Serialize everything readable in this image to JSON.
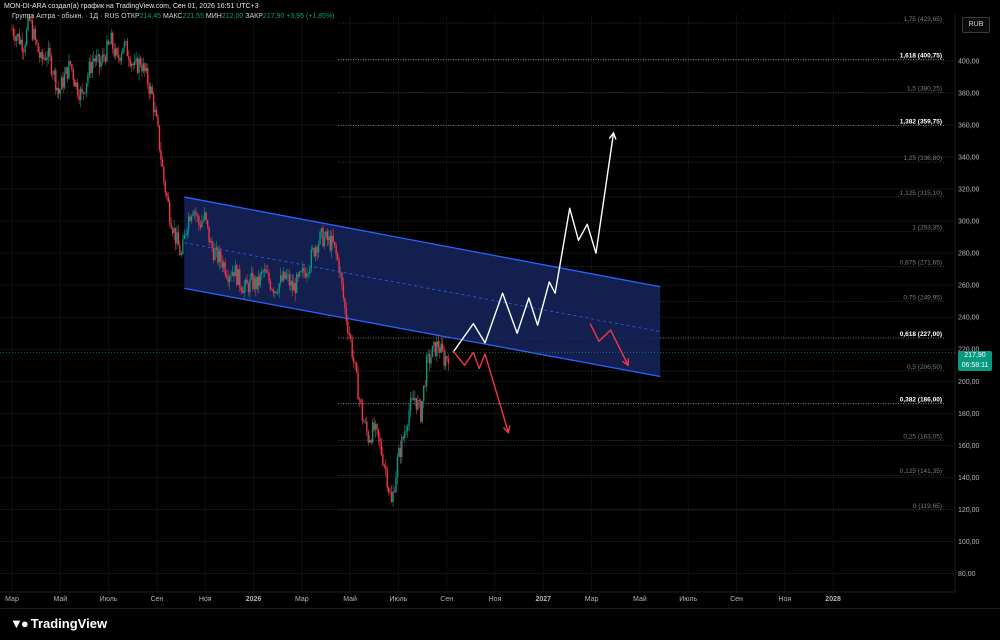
{
  "header": {
    "attribution": "MON-DI-ARA создал(а) график на TradingView.com, Сен 01, 2026 16:51 UTC+3",
    "symbol_line": "Группа Астра - обыкн. · 1Д · RUS",
    "open_label": "ОТКР",
    "open_value": "214,45",
    "high_label": "МАКС",
    "high_value": "221,55",
    "low_label": "МИН",
    "low_value": "212,00",
    "close_label": "ЗАКР",
    "close_value": "217,90",
    "change": "+3,95 (+1,85%)"
  },
  "price_axis": {
    "currency": "RUB",
    "last_price": "217,90",
    "countdown": "06:58:11"
  },
  "footer": {
    "brand": "TradingView"
  },
  "colors": {
    "background": "#000000",
    "bull": "#089981",
    "bear": "#f23645",
    "channel_line": "#2962ff",
    "channel_fill": "#16255c",
    "fib_line": "#787b86",
    "scenario_up": "#ffffff",
    "scenario_down": "#f23645",
    "badge": "#089981"
  },
  "chart_data": {
    "type": "candlestick",
    "ylim": [
      75,
      430
    ],
    "price_ticks": [
      "400,00",
      "380,00",
      "360,00",
      "340,00",
      "320,00",
      "300,00",
      "280,00",
      "260,00",
      "240,00",
      "220,00",
      "200,00",
      "180,00",
      "160,00",
      "140,00",
      "120,00",
      "100,00",
      "80,00"
    ],
    "time_ticks": [
      "Мар",
      "Май",
      "Июль",
      "Сен",
      "Ноя",
      "2026",
      "Мар",
      "Май",
      "Июль",
      "Сен",
      "Ноя",
      "2027",
      "Мар",
      "Май",
      "Июль",
      "Сен",
      "Ноя",
      "2028"
    ],
    "fib_levels": [
      {
        "label": "1,75 (423,65)",
        "value": 423.65,
        "bold": false
      },
      {
        "label": "1,618 (400,75)",
        "value": 400.75,
        "bold": true
      },
      {
        "label": "1,5 (380,25)",
        "value": 380.25,
        "bold": false
      },
      {
        "label": "1,382 (359,75)",
        "value": 359.75,
        "bold": true
      },
      {
        "label": "1,25 (336,80)",
        "value": 336.8,
        "bold": false
      },
      {
        "label": "1,125 (315,10)",
        "value": 315.1,
        "bold": false
      },
      {
        "label": "1 (293,35)",
        "value": 293.35,
        "bold": false
      },
      {
        "label": "0,875 (271,65)",
        "value": 271.65,
        "bold": false
      },
      {
        "label": "0,75 (249,95)",
        "value": 249.95,
        "bold": false
      },
      {
        "label": "0,618 (227,00)",
        "value": 227.0,
        "bold": true
      },
      {
        "label": "0,5 (206,50)",
        "value": 206.5,
        "bold": false
      },
      {
        "label": "0,382 (186,00)",
        "value": 186.0,
        "bold": true
      },
      {
        "label": "0,25 (163,05)",
        "value": 163.05,
        "bold": false
      },
      {
        "label": "0,125 (141,35)",
        "value": 141.35,
        "bold": false
      },
      {
        "label": "0 (119,65)",
        "value": 119.65,
        "bold": false
      }
    ],
    "last_price": 217.9,
    "price_path": [
      [
        0,
        420
      ],
      [
        2,
        415
      ],
      [
        4,
        410
      ],
      [
        6,
        425
      ],
      [
        8,
        412
      ],
      [
        10,
        400
      ],
      [
        12,
        405
      ],
      [
        14,
        395
      ],
      [
        16,
        380
      ],
      [
        18,
        390
      ],
      [
        20,
        398
      ],
      [
        22,
        385
      ],
      [
        24,
        378
      ],
      [
        26,
        392
      ],
      [
        28,
        402
      ],
      [
        30,
        397
      ],
      [
        32,
        405
      ],
      [
        34,
        412
      ],
      [
        36,
        400
      ],
      [
        38,
        410
      ],
      [
        40,
        405
      ],
      [
        42,
        395
      ],
      [
        44,
        400
      ],
      [
        46,
        390
      ],
      [
        48,
        378
      ],
      [
        50,
        355
      ],
      [
        52,
        325
      ],
      [
        54,
        305
      ],
      [
        56,
        290
      ],
      [
        58,
        278
      ],
      [
        60,
        300
      ],
      [
        62,
        310
      ],
      [
        64,
        298
      ],
      [
        66,
        302
      ],
      [
        68,
        285
      ],
      [
        70,
        278
      ],
      [
        72,
        275
      ],
      [
        74,
        268
      ],
      [
        76,
        270
      ],
      [
        78,
        262
      ],
      [
        80,
        258
      ],
      [
        82,
        262
      ],
      [
        84,
        260
      ],
      [
        86,
        268
      ],
      [
        88,
        263
      ],
      [
        90,
        258
      ],
      [
        92,
        262
      ],
      [
        94,
        265
      ],
      [
        96,
        258
      ],
      [
        98,
        262
      ],
      [
        100,
        268
      ],
      [
        102,
        275
      ],
      [
        104,
        285
      ],
      [
        106,
        290
      ],
      [
        108,
        288
      ],
      [
        110,
        285
      ],
      [
        112,
        272
      ],
      [
        114,
        245
      ],
      [
        116,
        225
      ],
      [
        118,
        200
      ],
      [
        120,
        178
      ],
      [
        122,
        165
      ],
      [
        124,
        170
      ],
      [
        126,
        160
      ],
      [
        128,
        145
      ],
      [
        130,
        123
      ],
      [
        132,
        150
      ],
      [
        134,
        165
      ],
      [
        136,
        182
      ],
      [
        138,
        190
      ],
      [
        140,
        180
      ],
      [
        142,
        210
      ],
      [
        144,
        218
      ],
      [
        146,
        223
      ],
      [
        148,
        214
      ],
      [
        150,
        217.9
      ]
    ],
    "channel": {
      "top": [
        [
          0,
          315
        ],
        [
          1,
          259
        ]
      ],
      "bottom": [
        [
          0,
          258
        ],
        [
          1,
          203
        ]
      ],
      "start_index": 59,
      "end_day": 222
    },
    "scenario_up": [
      [
        151,
        218
      ],
      [
        158,
        236
      ],
      [
        162,
        224
      ],
      [
        168,
        255
      ],
      [
        173,
        230
      ],
      [
        177,
        252
      ],
      [
        180,
        235
      ],
      [
        184,
        262
      ],
      [
        186,
        255
      ],
      [
        191,
        308
      ],
      [
        194,
        288
      ],
      [
        197,
        298
      ],
      [
        200,
        280
      ],
      [
        206,
        355
      ]
    ],
    "scenario_down_long": [
      [
        151,
        219
      ],
      [
        155,
        210
      ],
      [
        158,
        218
      ],
      [
        160,
        208
      ],
      [
        162,
        217
      ],
      [
        170,
        168
      ]
    ],
    "scenario_down_short": [
      [
        198,
        236
      ],
      [
        201,
        225
      ],
      [
        205,
        232
      ],
      [
        211,
        210
      ]
    ]
  }
}
